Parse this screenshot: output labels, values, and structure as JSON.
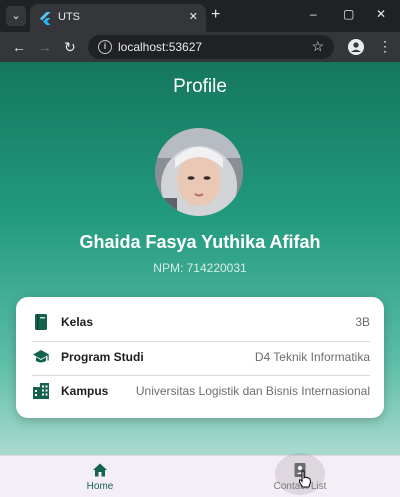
{
  "browser": {
    "tab_title": "UTS",
    "tab_close": "✕",
    "new_tab": "+",
    "url": "localhost:53627",
    "window_controls": [
      "–",
      "▢",
      "✕"
    ],
    "icons": [
      "flutter-logo-icon",
      "back-icon",
      "forward-icon",
      "reload-icon",
      "info-icon",
      "star-icon",
      "account-icon",
      "menu-icon"
    ]
  },
  "app": {
    "title": "Profile",
    "name": "Ghaida Fasya Yuthika Afifah",
    "npm": "NPM: 714220031",
    "details": [
      {
        "icon": "book-icon",
        "label": "Kelas",
        "value": "3B"
      },
      {
        "icon": "school-icon",
        "label": "Program Studi",
        "value": "D4 Teknik Informatika"
      },
      {
        "icon": "building-icon",
        "label": "Kampus",
        "value": "Universitas Logistik dan Bisnis Internasional"
      }
    ],
    "bottom_nav": [
      {
        "label": "Home",
        "icon": "home-icon",
        "active": true
      },
      {
        "label": "Contact List",
        "icon": "contacts-icon",
        "active": false
      }
    ]
  },
  "colors": {
    "primary": "#14614d",
    "gradient_top": "#15775d",
    "gradient_bottom": "#cde8e2",
    "card": "#ffffff",
    "nav_bg": "#f4eef6",
    "inactive": "#7a7a7a"
  }
}
